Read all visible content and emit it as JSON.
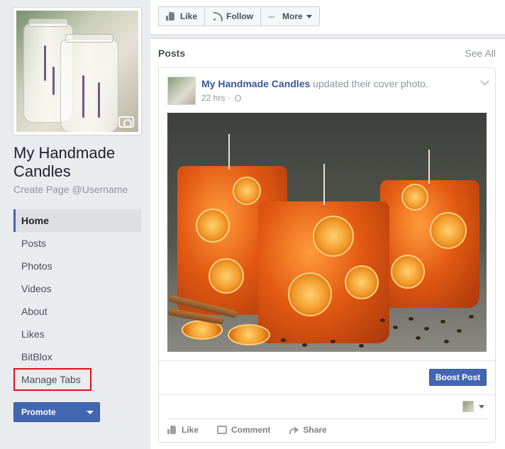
{
  "page": {
    "name": "My Handmade Candles",
    "username_prompt": "Create Page @Username"
  },
  "sidebar": {
    "items": [
      {
        "label": "Home",
        "active": true
      },
      {
        "label": "Posts"
      },
      {
        "label": "Photos"
      },
      {
        "label": "Videos"
      },
      {
        "label": "About"
      },
      {
        "label": "Likes"
      },
      {
        "label": "BitBlox"
      }
    ],
    "manage_tabs": "Manage Tabs",
    "promote": "Promote"
  },
  "actions": {
    "like": "Like",
    "follow": "Follow",
    "more": "More"
  },
  "posts": {
    "title": "Posts",
    "see_all": "See All",
    "post": {
      "author": "My Handmade Candles",
      "action_text": "updated their cover photo.",
      "time": "22 hrs ·",
      "boost": "Boost Post",
      "like": "Like",
      "comment": "Comment",
      "share": "Share"
    }
  },
  "colors": {
    "brand_blue": "#4267b2",
    "link_blue": "#365899",
    "highlight_red": "#e0101b",
    "background": "#e9ebee"
  },
  "icons": [
    "camera-icon",
    "thumbs-up-icon",
    "rss-icon",
    "dots-icon",
    "globe-icon",
    "chevron-down-icon",
    "comment-icon",
    "share-icon"
  ]
}
